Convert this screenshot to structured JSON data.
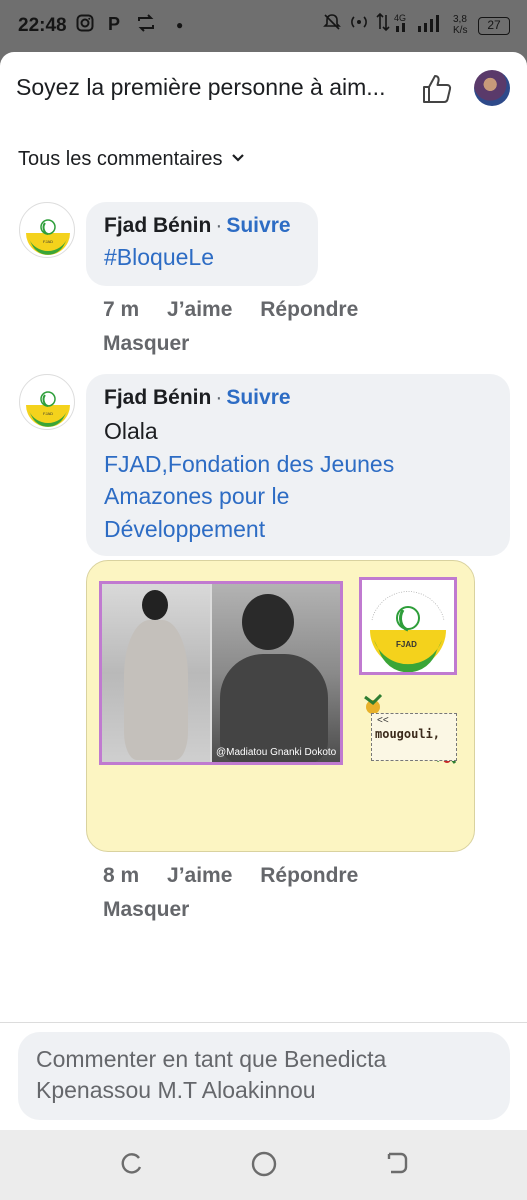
{
  "status_bar": {
    "time": "22:48",
    "left_icons": [
      "instagram-icon",
      "p-app-icon",
      "repost-icon",
      "dot-icon"
    ],
    "network_speed": "3,8\nK/s",
    "battery": "27"
  },
  "likes_bar": {
    "text": "Soyez la première personne à aim...",
    "like_icon": "thumbs-up-outline-icon"
  },
  "filter": {
    "label": "Tous les commentaires"
  },
  "comments": [
    {
      "author": "Fjad Bénin",
      "separator": "·",
      "follow_label": "Suivre",
      "hashtag": "#BloqueLe",
      "time": "7 m",
      "like_label": "J’aime",
      "reply_label": "Répondre",
      "hide_label": "Masquer"
    },
    {
      "author": "Fjad Bénin",
      "separator": "·",
      "follow_label": "Suivre",
      "text": "Olala",
      "link_lines": [
        "FJAD,Fondation des Jeunes",
        "Amazones pour le",
        "Développement"
      ],
      "attachment": {
        "photo_credit": "@Madiatou Gnanki Dokoto",
        "sticker_text": "mougouli,",
        "logo_label": "FJAD"
      },
      "time": "8 m",
      "like_label": "J’aime",
      "reply_label": "Répondre",
      "hide_label": "Masquer"
    }
  ],
  "composer": {
    "placeholder": "Commenter en tant que Benedicta Kpenassou M.T Aloakinnou"
  },
  "nav": {
    "buttons": [
      "recent-apps-icon",
      "home-icon",
      "back-icon"
    ]
  },
  "colors": {
    "link_blue": "#2d6cc4",
    "bubble_gray": "#eff1f4",
    "attachment_bg": "#fcf5c2",
    "frame_purple": "#c07ad0"
  }
}
